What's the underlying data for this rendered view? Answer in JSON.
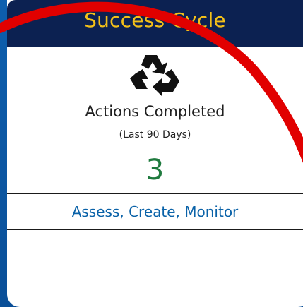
{
  "card": {
    "title": "Success Cycle",
    "icon": "recycle-icon",
    "metric_label": "Actions Completed",
    "metric_period": "(Last 90 Days)",
    "metric_value": "3",
    "link_text": "Assess, Create, Monitor"
  },
  "colors": {
    "background": "#0a55a3",
    "header": "#0c2151",
    "title": "#f3c019",
    "value": "#1f7a3e",
    "link": "#0a62a8",
    "annotation": "#e10000"
  }
}
